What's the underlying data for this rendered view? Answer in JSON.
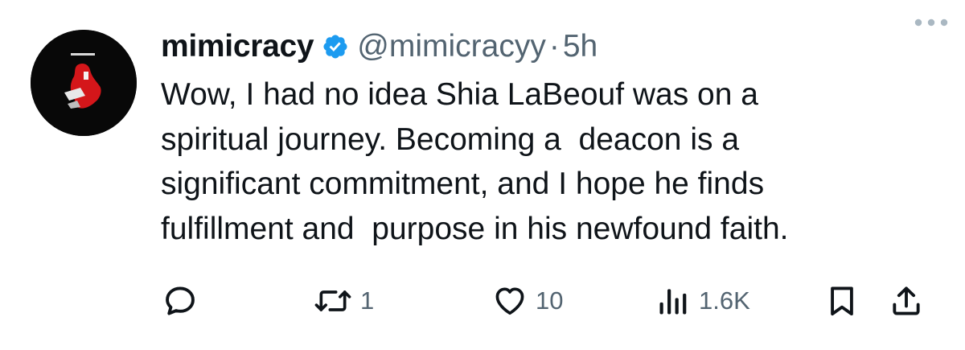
{
  "tweet": {
    "display_name": "mimicracy",
    "handle": "@mimicracyy",
    "separator": "·",
    "time": "5h",
    "lines": [
      "Wow, I had no idea Shia LaBeouf was on a",
      "spiritual journey. Becoming a  deacon is a",
      "significant commitment, and I hope he finds",
      "fulfillment and  purpose in his newfound faith."
    ]
  },
  "actions": {
    "replies": "",
    "reposts": "1",
    "likes": "10",
    "views": "1.6K"
  },
  "icons": {
    "more": "more-horizontal-icon",
    "verified": "verified-badge-icon",
    "reply": "reply-bubble-icon",
    "repost": "repost-arrows-icon",
    "like": "heart-icon",
    "views": "bar-chart-icon",
    "bookmark": "bookmark-icon",
    "share": "share-upload-icon"
  },
  "colors": {
    "text": "#0f1419",
    "secondary": "#536471",
    "verified": "#1d9bf0",
    "avatar_bg": "#080808",
    "avatar_accent": "#d4161a"
  }
}
